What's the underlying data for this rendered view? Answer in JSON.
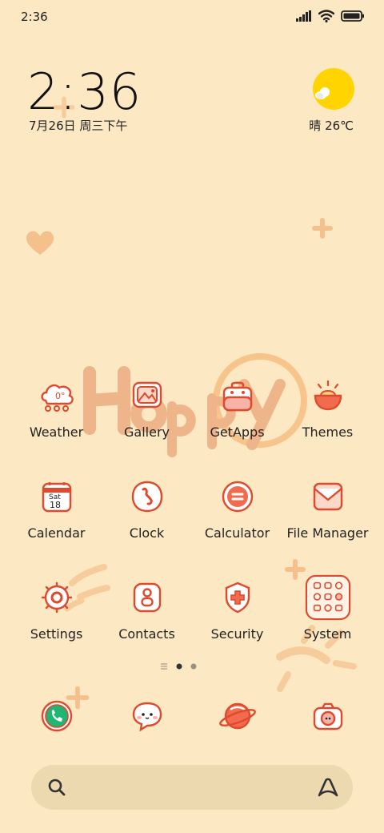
{
  "status_bar": {
    "time": "2:36"
  },
  "clock_widget": {
    "time": "2:36",
    "date": "7月26日 周三下午"
  },
  "weather_widget": {
    "summary": "晴 26℃"
  },
  "apps": [
    {
      "label": "Weather",
      "icon": "weather-icon"
    },
    {
      "label": "Gallery",
      "icon": "gallery-icon"
    },
    {
      "label": "GetApps",
      "icon": "getapps-icon"
    },
    {
      "label": "Themes",
      "icon": "themes-icon"
    },
    {
      "label": "Calendar",
      "icon": "calendar-icon"
    },
    {
      "label": "Clock",
      "icon": "clock-icon"
    },
    {
      "label": "Calculator",
      "icon": "calculator-icon"
    },
    {
      "label": "File Manager",
      "icon": "file-manager-icon"
    },
    {
      "label": "Settings",
      "icon": "settings-icon"
    },
    {
      "label": "Contacts",
      "icon": "contacts-icon"
    },
    {
      "label": "Security",
      "icon": "security-icon"
    },
    {
      "label": "System",
      "icon": "system-folder-icon"
    }
  ],
  "icon_text": {
    "weather": "0°",
    "calendar_month": "Sat",
    "calendar_day": "18"
  },
  "dock": [
    {
      "icon": "phone-icon"
    },
    {
      "icon": "messages-icon"
    },
    {
      "icon": "browser-icon"
    },
    {
      "icon": "camera-icon"
    }
  ],
  "wallpaper_text": "Happy",
  "colors": {
    "background": "#fde8c4",
    "accent": "#e0492c",
    "sun": "#ffd400",
    "search_bar": "#ecd9b0"
  }
}
